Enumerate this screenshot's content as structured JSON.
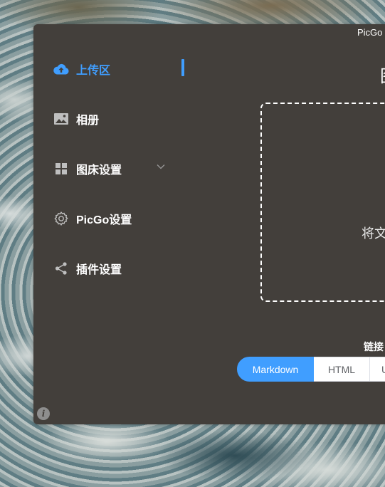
{
  "window": {
    "title": "PicGo"
  },
  "sidebar": {
    "items": [
      {
        "label": "上传区",
        "icon": "upload-cloud-icon",
        "active": true
      },
      {
        "label": "相册",
        "icon": "image-icon",
        "active": false
      },
      {
        "label": "图床设置",
        "icon": "grid-icon",
        "active": false,
        "has_submenu": true
      },
      {
        "label": "PicGo设置",
        "icon": "gear-icon",
        "active": false
      },
      {
        "label": "插件设置",
        "icon": "share-icon",
        "active": false
      }
    ]
  },
  "main": {
    "title": "图",
    "dropzone_text": "将文",
    "link_format_label": "链接",
    "formats": [
      {
        "label": "Markdown",
        "selected": true
      },
      {
        "label": "HTML",
        "selected": false
      },
      {
        "label": "U",
        "selected": false
      }
    ]
  },
  "footer": {
    "info_icon": "info-icon",
    "info_glyph": "i"
  },
  "colors": {
    "accent": "#409eff",
    "window_bg": "#433f3b",
    "text": "#ffffff"
  }
}
